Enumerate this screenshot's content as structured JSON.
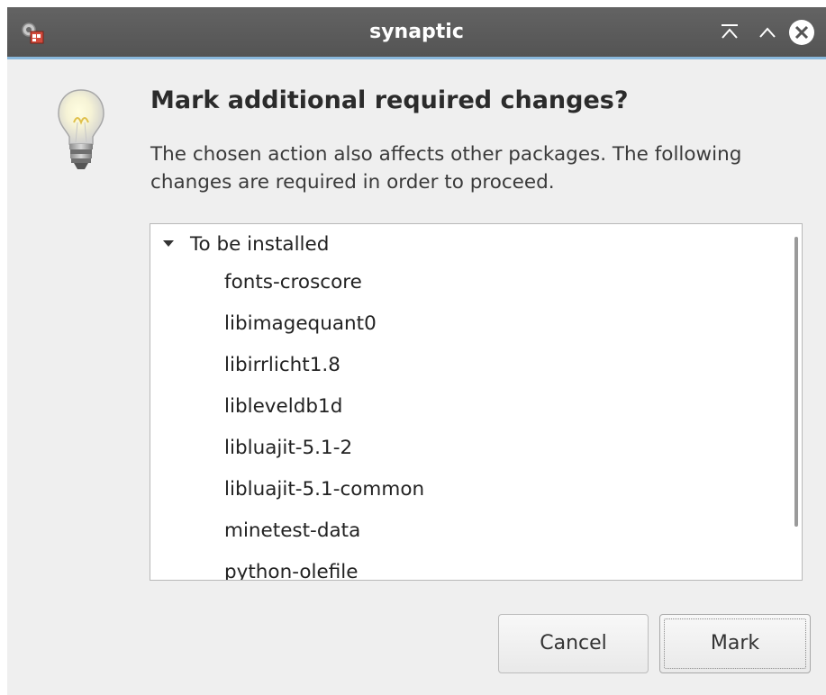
{
  "window": {
    "title": "synaptic",
    "app_icon": "synaptic-app-icon",
    "titlebar_color": "#5a5a5a",
    "titlebar_accent": "#8ab9dd"
  },
  "titlebar_buttons": {
    "keep_above_icon": "keep-above-icon",
    "maximize_icon": "maximize-icon",
    "close_icon": "close-icon"
  },
  "dialog": {
    "icon": "lightbulb-icon",
    "heading": "Mark additional required changes?",
    "description": "The chosen action also affects other packages. The following changes are required in order to proceed."
  },
  "changes": {
    "group_label": "To be installed",
    "expander_icon": "expander-down-icon",
    "packages": [
      "fonts-croscore",
      "libimagequant0",
      "libirrlicht1.8",
      "libleveldb1d",
      "libluajit-5.1-2",
      "libluajit-5.1-common",
      "minetest-data",
      "python-olefile"
    ]
  },
  "buttons": {
    "cancel": "Cancel",
    "mark": "Mark"
  }
}
